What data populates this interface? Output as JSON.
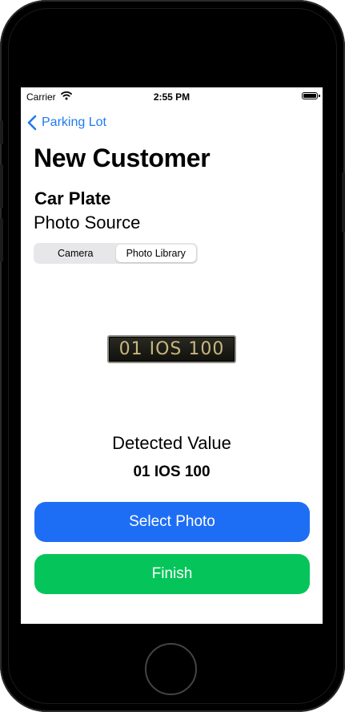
{
  "status_bar": {
    "carrier": "Carrier",
    "time": "2:55 PM"
  },
  "nav": {
    "back_label": "Parking Lot"
  },
  "page": {
    "title": "New Customer"
  },
  "section": {
    "heading": "Car Plate",
    "subheading": "Photo Source"
  },
  "photo_source": {
    "options": [
      "Camera",
      "Photo Library"
    ],
    "selected": "Photo Library"
  },
  "plate_image": {
    "text": "01 IOS 100"
  },
  "detection": {
    "label": "Detected Value",
    "value": "01 IOS 100"
  },
  "buttons": {
    "select_photo": "Select Photo",
    "finish": "Finish"
  },
  "colors": {
    "accent": "#1f7af0",
    "select_button": "#1e6ef5",
    "finish_button": "#05c55a"
  }
}
